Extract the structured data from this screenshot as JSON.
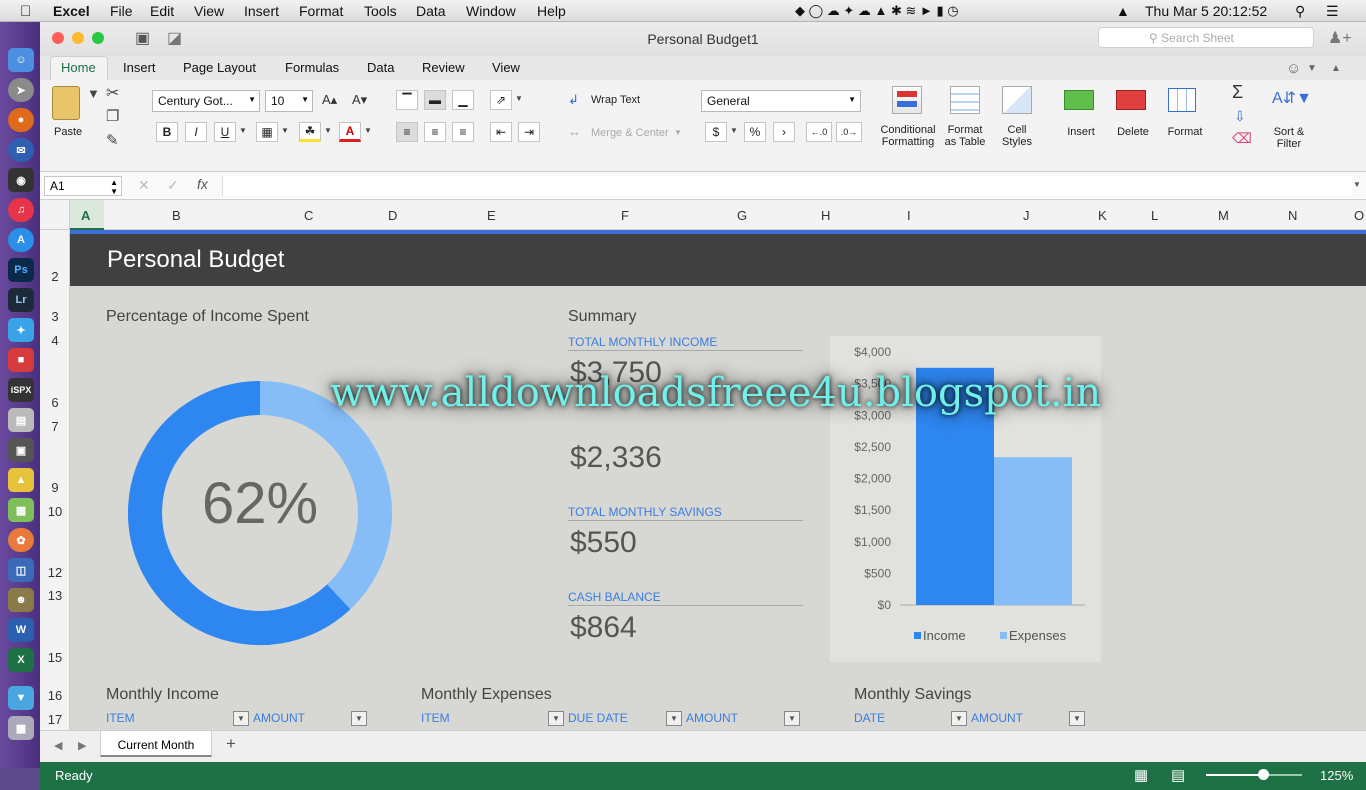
{
  "menubar": {
    "app": "Excel",
    "items": [
      "File",
      "Edit",
      "View",
      "Insert",
      "Format",
      "Tools",
      "Data",
      "Window",
      "Help"
    ],
    "clock": "Thu Mar 5  20:12:52"
  },
  "window": {
    "title": "Personal Budget1",
    "search_placeholder": "Search Sheet"
  },
  "ribbon_tabs": [
    "Home",
    "Insert",
    "Page Layout",
    "Formulas",
    "Data",
    "Review",
    "View"
  ],
  "ribbon": {
    "paste": "Paste",
    "font_name": "Century Got...",
    "font_size": "10",
    "bold": "B",
    "italic": "I",
    "underline": "U",
    "wrap_text": "Wrap Text",
    "merge_center": "Merge & Center",
    "number_format": "General",
    "currency": "$",
    "percent": "%",
    "comma": "›",
    "cond_format_1": "Conditional",
    "cond_format_2": "Formatting",
    "format_table_1": "Format",
    "format_table_2": "as Table",
    "cell_styles_1": "Cell",
    "cell_styles_2": "Styles",
    "insert": "Insert",
    "delete": "Delete",
    "format": "Format",
    "sort_filter_1": "Sort &",
    "sort_filter_2": "Filter"
  },
  "formula_bar": {
    "cell_ref": "A1",
    "fx": "fx"
  },
  "columns": [
    "A",
    "B",
    "C",
    "D",
    "E",
    "F",
    "G",
    "H",
    "I",
    "J",
    "K",
    "L",
    "M",
    "N",
    "O"
  ],
  "rows": [
    "2",
    "3",
    "4",
    "6",
    "7",
    "9",
    "10",
    "12",
    "13",
    "15",
    "16",
    "17"
  ],
  "sheet": {
    "banner_title": "Personal Budget",
    "pct_title": "Percentage of Income Spent",
    "pct_value": "62%",
    "summary_title": "Summary",
    "total_income_label": "TOTAL MONTHLY INCOME",
    "total_income_value": "$3,750",
    "total_expenses_value": "$2,336",
    "total_savings_label": "TOTAL MONTHLY SAVINGS",
    "total_savings_value": "$550",
    "cash_balance_label": "CASH BALANCE",
    "cash_balance_value": "$864",
    "monthly_income": "Monthly Income",
    "monthly_expenses": "Monthly Expenses",
    "monthly_savings": "Monthly Savings",
    "h_item": "ITEM",
    "h_amount": "AMOUNT",
    "h_due_date": "DUE DATE",
    "h_date": "DATE"
  },
  "watermark": "www.alldownloadsfreee4u.blogspot.in",
  "sheet_tabs": {
    "current": "Current Month",
    "add": "+"
  },
  "status": {
    "ready": "Ready",
    "zoom": "125%"
  },
  "colors": {
    "income": "#2e86f0",
    "expenses": "#86bdf7",
    "accent": "#3b7de0",
    "status_bar": "#1e7145"
  },
  "chart_data": [
    {
      "type": "pie",
      "values": [
        62,
        38
      ],
      "center_label": "62%"
    },
    {
      "type": "bar",
      "categories": [
        "Income",
        "Expenses"
      ],
      "values": [
        3750,
        2336
      ],
      "yticks": [
        "$4,000",
        "$3,500",
        "$3,000",
        "$2,500",
        "$2,000",
        "$1,500",
        "$1,000",
        "$500",
        "$0"
      ],
      "ylim": [
        0,
        4000
      ],
      "legend": [
        "Income",
        "Expenses"
      ],
      "legend_position": "bottom"
    }
  ]
}
